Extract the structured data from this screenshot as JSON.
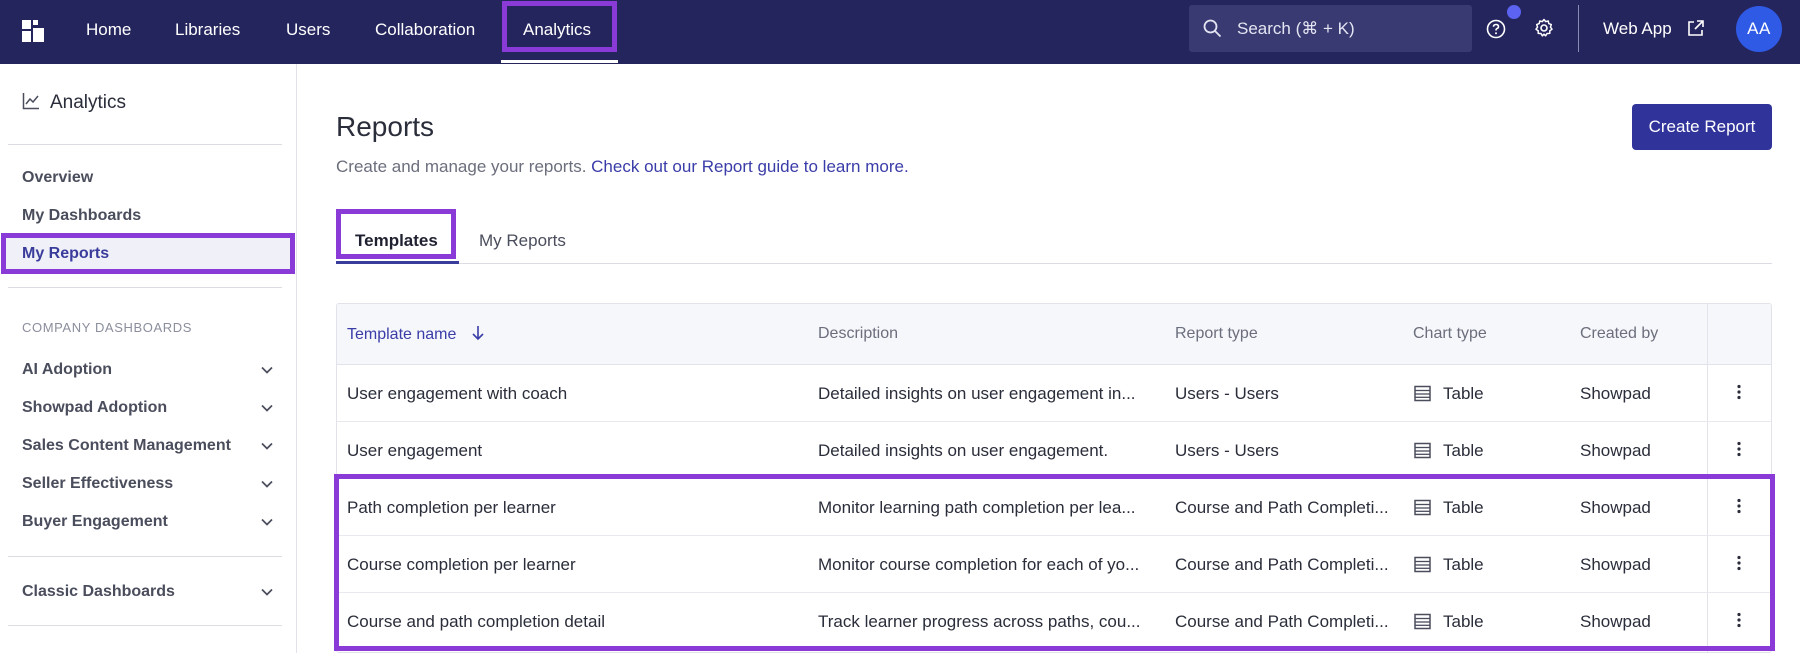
{
  "nav": {
    "items": [
      {
        "label": "Home"
      },
      {
        "label": "Libraries"
      },
      {
        "label": "Users"
      },
      {
        "label": "Collaboration"
      },
      {
        "label": "Analytics",
        "active": true
      }
    ],
    "search_placeholder": "Search (⌘ + K)",
    "web_app_label": "Web App",
    "avatar_initials": "AA"
  },
  "sidebar": {
    "title": "Analytics",
    "items": [
      {
        "label": "Overview"
      },
      {
        "label": "My Dashboards"
      },
      {
        "label": "My Reports",
        "active": true
      }
    ],
    "section_label": "COMPANY DASHBOARDS",
    "groups": [
      {
        "label": "AI Adoption"
      },
      {
        "label": "Showpad Adoption"
      },
      {
        "label": "Sales Content Management"
      },
      {
        "label": "Seller Effectiveness"
      },
      {
        "label": "Buyer Engagement"
      }
    ],
    "classic": {
      "label": "Classic Dashboards"
    }
  },
  "main": {
    "title": "Reports",
    "subtitle": "Create and manage your reports.",
    "subtitle_link": "Check out our Report guide to learn more.",
    "create_button": "Create Report",
    "tabs": [
      {
        "label": "Templates",
        "active": true
      },
      {
        "label": "My Reports"
      }
    ]
  },
  "table": {
    "columns": [
      "Template name",
      "Description",
      "Report type",
      "Chart type",
      "Created by"
    ],
    "sorted_column": "Template name",
    "sort_direction": "descending",
    "rows": [
      {
        "name": "User engagement with coach",
        "description": "Detailed insights on user engagement in...",
        "report_type": "Users - Users",
        "chart_type": "Table",
        "created_by": "Showpad"
      },
      {
        "name": "User engagement",
        "description": "Detailed insights on user engagement.",
        "report_type": "Users - Users",
        "chart_type": "Table",
        "created_by": "Showpad"
      },
      {
        "name": "Path completion per learner",
        "description": "Monitor learning path completion per lea...",
        "report_type": "Course and Path Completi...",
        "chart_type": "Table",
        "created_by": "Showpad"
      },
      {
        "name": "Course completion per learner",
        "description": "Monitor course completion for each of yo...",
        "report_type": "Course and Path Completi...",
        "chart_type": "Table",
        "created_by": "Showpad"
      },
      {
        "name": "Course and path completion detail",
        "description": "Track learner progress across paths, cou...",
        "report_type": "Course and Path Completi...",
        "chart_type": "Table",
        "created_by": "Showpad"
      }
    ]
  },
  "colors": {
    "topbar": "#25255e",
    "accent": "#30339a",
    "highlight": "#8a3ad6",
    "avatar": "#2f5ae6"
  }
}
